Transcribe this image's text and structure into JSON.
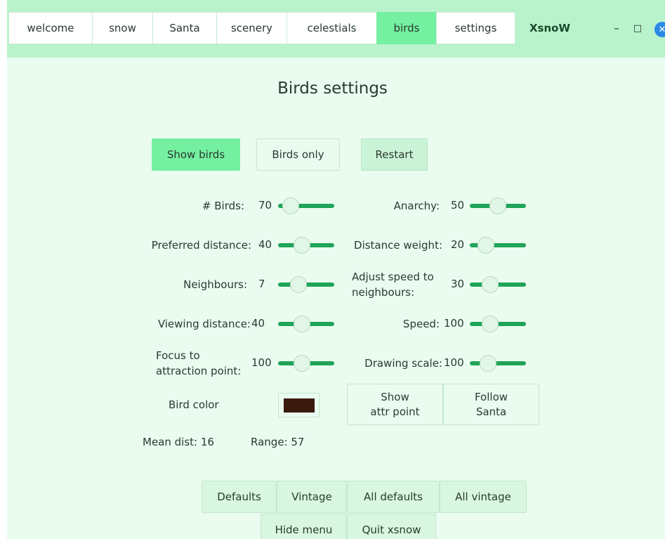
{
  "tabs": [
    "welcome",
    "snow",
    "Santa",
    "scenery",
    "celestials",
    "birds",
    "settings"
  ],
  "active_tab": "birds",
  "app_name": "XsnoW",
  "window_controls": {
    "minimize": "–",
    "maximize": "□",
    "close": "✕"
  },
  "page_title": "Birds settings",
  "toggles": {
    "show_birds": "Show birds",
    "birds_only": "Birds only",
    "restart": "Restart"
  },
  "params": {
    "birds": {
      "label": "# Birds:",
      "value": "70",
      "level": 0.1
    },
    "preferred_distance": {
      "label": "Preferred distance:",
      "value": "40",
      "level": 0.4
    },
    "neighbours": {
      "label": "Neighbours:",
      "value": "7",
      "level": 0.3
    },
    "viewing_distance": {
      "label": "Viewing distance:",
      "value": "40",
      "level": 0.4
    },
    "focus": {
      "label_line1": "Focus to",
      "label_line2": "attraction point:",
      "value": "100",
      "level": 0.4
    },
    "anarchy": {
      "label": "Anarchy:",
      "value": "50",
      "level": 0.5
    },
    "distance_weight": {
      "label": "Distance weight:",
      "value": "20",
      "level": 0.2
    },
    "adjust_speed": {
      "label_line1": "Adjust speed to",
      "label_line2": "neighbours:",
      "value": "30",
      "level": 0.3
    },
    "speed": {
      "label": "Speed:",
      "value": "100",
      "level": 0.3
    },
    "drawing_scale": {
      "label": "Drawing scale:",
      "value": "100",
      "level": 0.25
    }
  },
  "bird_color": {
    "label": "Bird color",
    "color": "#3a1a0e"
  },
  "show_attr_point": {
    "line1": "Show",
    "line2": "attr point"
  },
  "follow_santa": {
    "line1": "Follow",
    "line2": "Santa"
  },
  "stats": {
    "mean_dist": "Mean dist: 16",
    "range": "Range: 57"
  },
  "footer": {
    "defaults": "Defaults",
    "vintage": "Vintage",
    "all_defaults": "All defaults",
    "all_vintage": "All vintage",
    "hide_menu": "Hide menu",
    "quit": "Quit xsnow"
  },
  "colors": {
    "accent": "#74f0a0",
    "slider": "#1fa45a",
    "background": "#eafbef",
    "topbar": "#b9f3cc"
  }
}
